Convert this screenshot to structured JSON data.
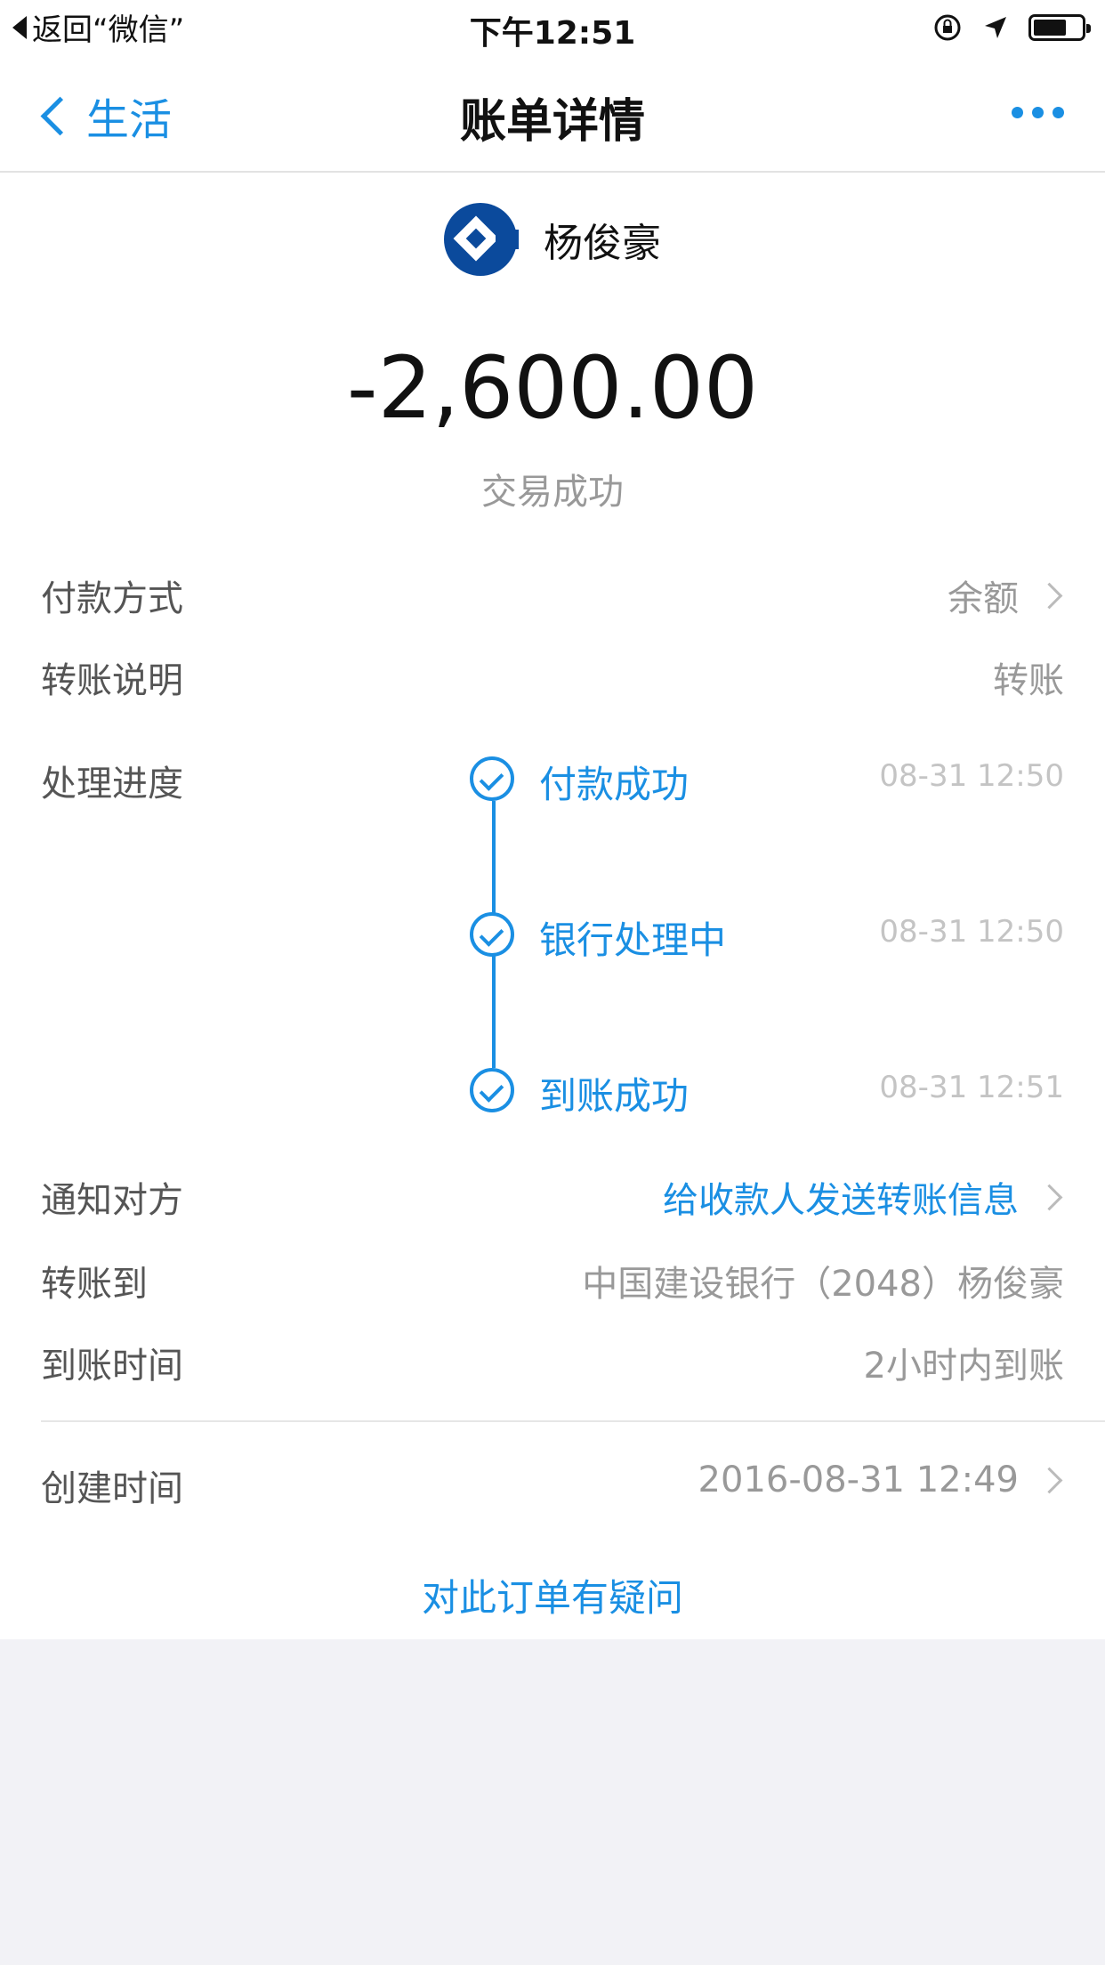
{
  "status_bar": {
    "back_app": "返回“微信”",
    "time": "下午12:51"
  },
  "nav": {
    "back_label": "生活",
    "title": "账单详情"
  },
  "payee": {
    "name": "杨俊豪"
  },
  "amount": "-2,600.00",
  "transaction_status": "交易成功",
  "rows": {
    "payment_method": {
      "label": "付款方式",
      "value": "余额"
    },
    "transfer_note": {
      "label": "转账说明",
      "value": "转账"
    },
    "progress_label": "处理进度",
    "notify": {
      "label": "通知对方",
      "value": "给收款人发送转账信息"
    },
    "transfer_to": {
      "label": "转账到",
      "value": "中国建设银行（2048）杨俊豪"
    },
    "arrival_time": {
      "label": "到账时间",
      "value": "2小时内到账"
    },
    "created_time": {
      "label": "创建时间",
      "value": "2016-08-31 12:49"
    }
  },
  "progress": [
    {
      "label": "付款成功",
      "time": "08-31 12:50"
    },
    {
      "label": "银行处理中",
      "time": "08-31 12:50"
    },
    {
      "label": "到账成功",
      "time": "08-31 12:51"
    }
  ],
  "question_link": "对此订单有疑问",
  "colors": {
    "accent": "#1a8fe3",
    "bank_logo": "#0b4a9c",
    "page_bg": "#f2f2f6"
  }
}
